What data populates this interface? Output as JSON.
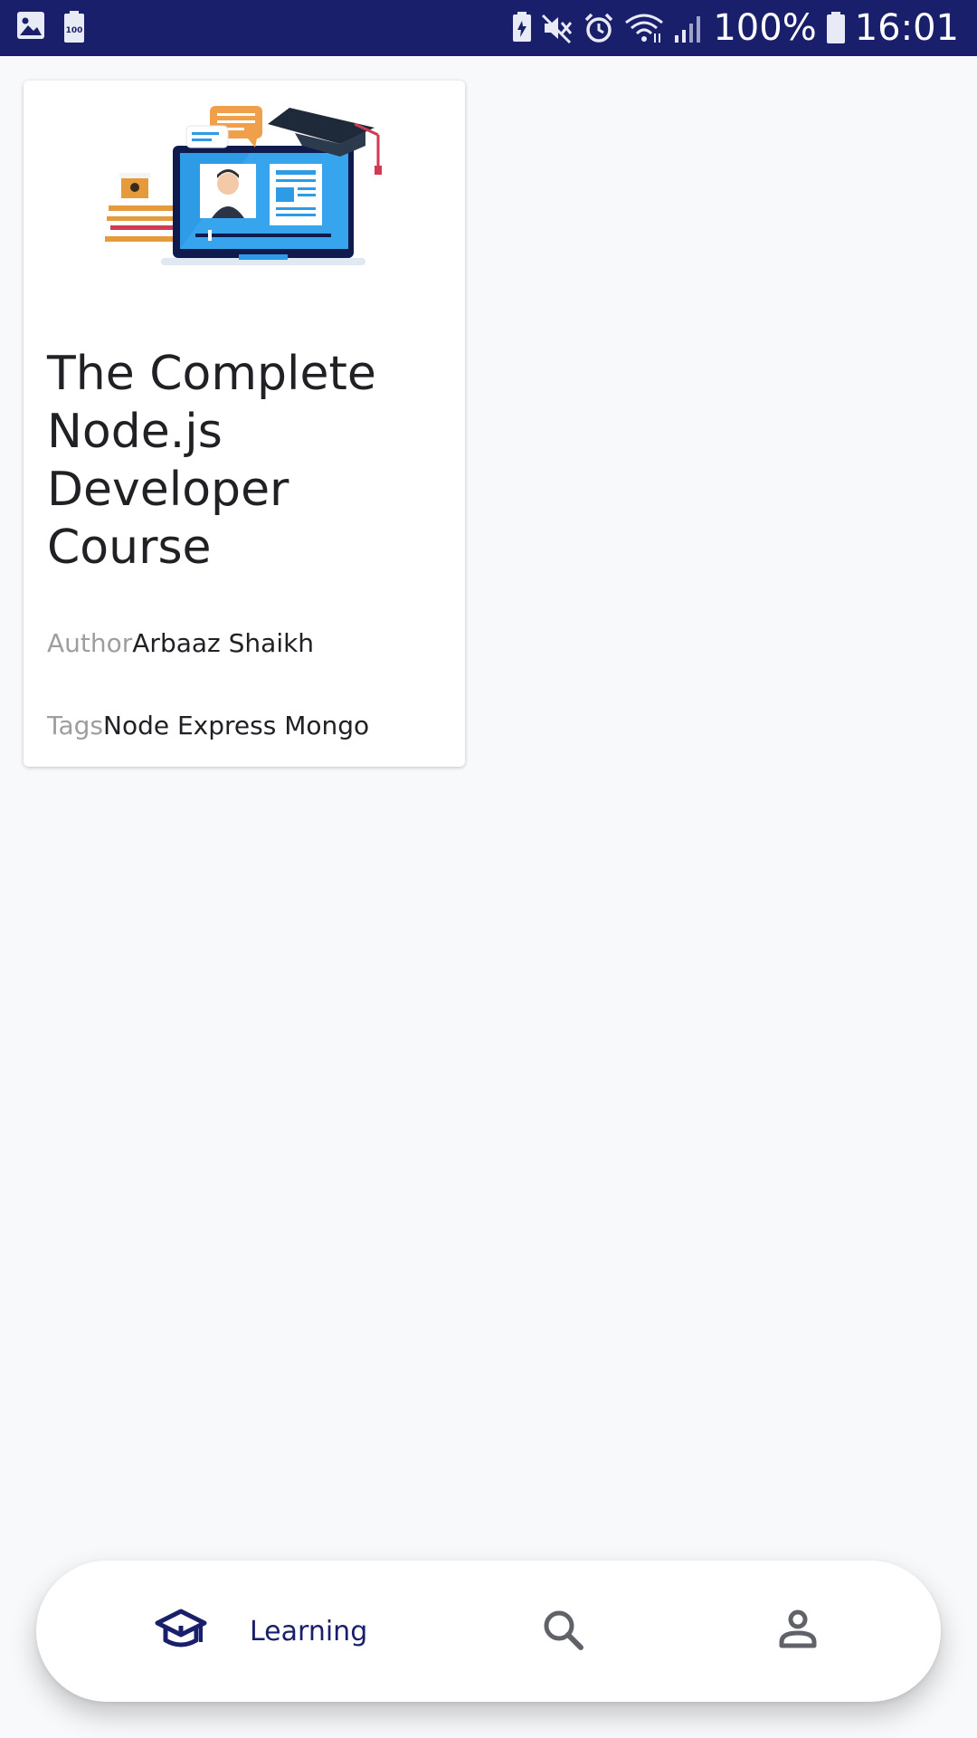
{
  "status_bar": {
    "battery_percent": "100%",
    "time": "16:01",
    "left_icons": [
      "gallery-icon",
      "battery-100-notification-icon"
    ],
    "right_icons": [
      "battery-saver-icon",
      "mute-icon",
      "alarm-icon",
      "wifi-icon",
      "signal-icon",
      "battery-icon"
    ],
    "background_color": "#1a1f6b"
  },
  "course_card": {
    "illustration_icon": "online-course-illustration",
    "title": "The Complete Node.js Developer Course",
    "author_label": "Author",
    "author_value": "Arbaaz Shaikh",
    "tags_label": "Tags",
    "tags_value": "Node Express Mongo"
  },
  "bottom_nav": {
    "items": [
      {
        "name": "learning",
        "label": "Learning",
        "icon": "graduation-cap-icon",
        "active": true
      },
      {
        "name": "search",
        "label": "",
        "icon": "search-icon",
        "active": false
      },
      {
        "name": "profile",
        "label": "",
        "icon": "person-icon",
        "active": false
      }
    ],
    "active_color": "#1a1f6b",
    "inactive_color": "#5f6368"
  }
}
